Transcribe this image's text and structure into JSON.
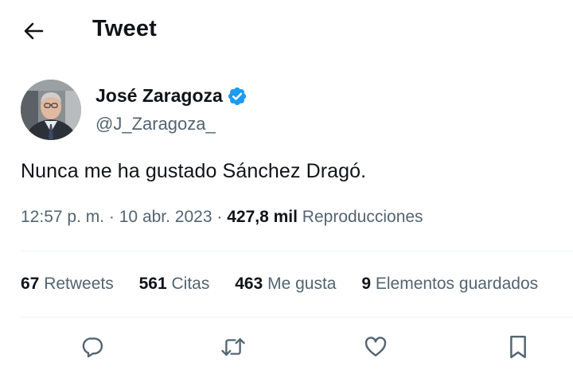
{
  "header": {
    "title": "Tweet",
    "back_icon": "arrow-left-icon"
  },
  "author": {
    "name": "José Zaragoza",
    "handle": "@J_Zaragoza_",
    "verified_icon": "verified-badge-icon",
    "verified_color": "#1d9bf0"
  },
  "tweet": {
    "text": "Nunca me ha gustado Sánchez Dragó."
  },
  "meta": {
    "time": "12:57 p. m.",
    "separator": "·",
    "date": "10 abr. 2023",
    "views_count": "427,8 mil",
    "views_label": "Reproducciones"
  },
  "stats": {
    "retweets_count": "67",
    "retweets_label": "Retweets",
    "quotes_count": "561",
    "quotes_label": "Citas",
    "likes_count": "463",
    "likes_label": "Me gusta",
    "bookmarks_count": "9",
    "bookmarks_label": "Elementos guardados"
  },
  "actions": {
    "reply_icon": "reply-icon",
    "retweet_icon": "retweet-icon",
    "like_icon": "heart-icon",
    "bookmark_icon": "bookmark-icon"
  },
  "colors": {
    "text_primary": "#0f1419",
    "text_secondary": "#536471",
    "divider": "#eff3f4"
  }
}
